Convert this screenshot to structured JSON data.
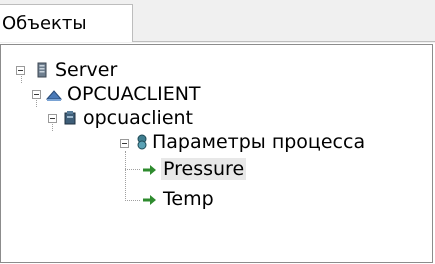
{
  "tabs": [
    {
      "label": "Объекты",
      "active": true
    }
  ],
  "tree": {
    "nodes": [
      {
        "label": "Server",
        "icon": "server-icon",
        "expanded": true
      },
      {
        "label": "OPCUACLIENT",
        "icon": "computer-icon",
        "expanded": true
      },
      {
        "label": "opcuaclient",
        "icon": "device-icon",
        "expanded": true
      },
      {
        "label": "Параметры процесса",
        "icon": "folder-group-icon",
        "expanded": true
      },
      {
        "label": "Pressure",
        "icon": "tag-arrow-icon",
        "selected": true
      },
      {
        "label": "Temp",
        "icon": "tag-arrow-icon",
        "selected": false
      }
    ]
  },
  "colors": {
    "arrow_green": "#2e8b2e",
    "selection": "#e8e8e8"
  }
}
